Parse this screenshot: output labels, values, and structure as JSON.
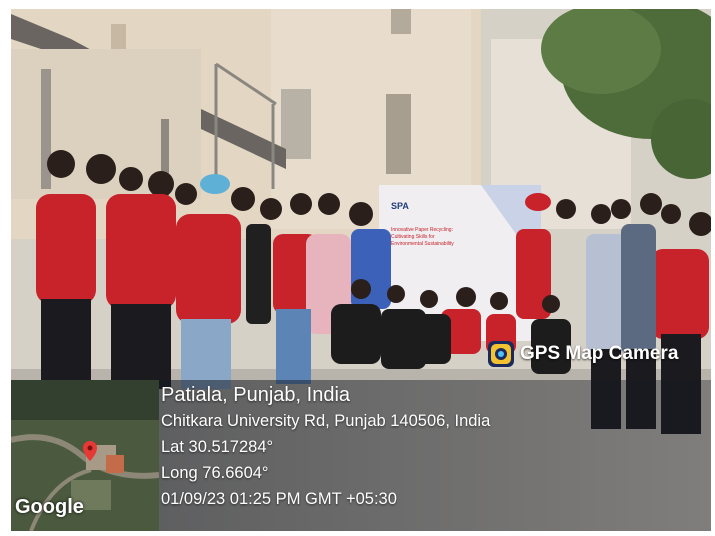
{
  "overlay": {
    "app_label": "GPS Map Camera",
    "location_title": "Patiala, Punjab, India",
    "address": "Chitkara University Rd, Punjab 140506, India",
    "latitude": "Lat 30.517284°",
    "longitude": "Long 76.6604°",
    "datetime": "01/09/23 01:25 PM GMT +05:30",
    "map_brand": "Google"
  },
  "icons": {
    "gps_app": "gps-map-camera-icon",
    "map_pin": "map-pin-icon"
  },
  "colors": {
    "shirt_red": "#c8222b",
    "banner_blue": "#3a5aa8",
    "overlay": "#141923"
  }
}
